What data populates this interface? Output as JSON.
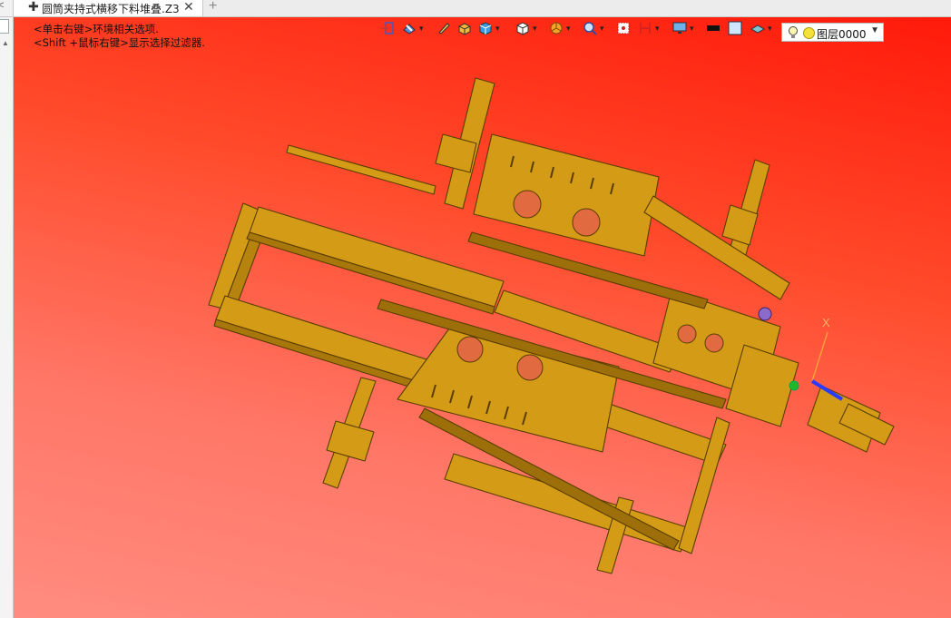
{
  "tabs": {
    "active_title": "圆筒夹持式横移下料堆叠.Z3",
    "pin_glyph": "✚",
    "close_glyph": "✕",
    "new_glyph": "+"
  },
  "viewport": {
    "hint_line1": "<单击右键>环境相关选项.",
    "hint_line2": "<Shift +鼠标右键>显示选择过滤器.",
    "background_top": "#ff1a0a",
    "background_bottom": "#ff8c80"
  },
  "toolbar": {
    "icons": [
      "exit-sketch-icon",
      "render-mode-icon",
      "pen-icon",
      "box-yellow-icon",
      "cube-blue-icon",
      "cube-white-icon",
      "pizza-section-icon",
      "zoom-icon",
      "snap-icon",
      "dimension-icon",
      "monitor-icon",
      "color-black-swatch-icon",
      "color-white-swatch-icon",
      "layer-style-icon"
    ],
    "layer_name": "图层0000"
  },
  "model": {
    "part_color": "#d49b16",
    "part_stroke": "#5a3d00",
    "triad_x_label": "X"
  }
}
